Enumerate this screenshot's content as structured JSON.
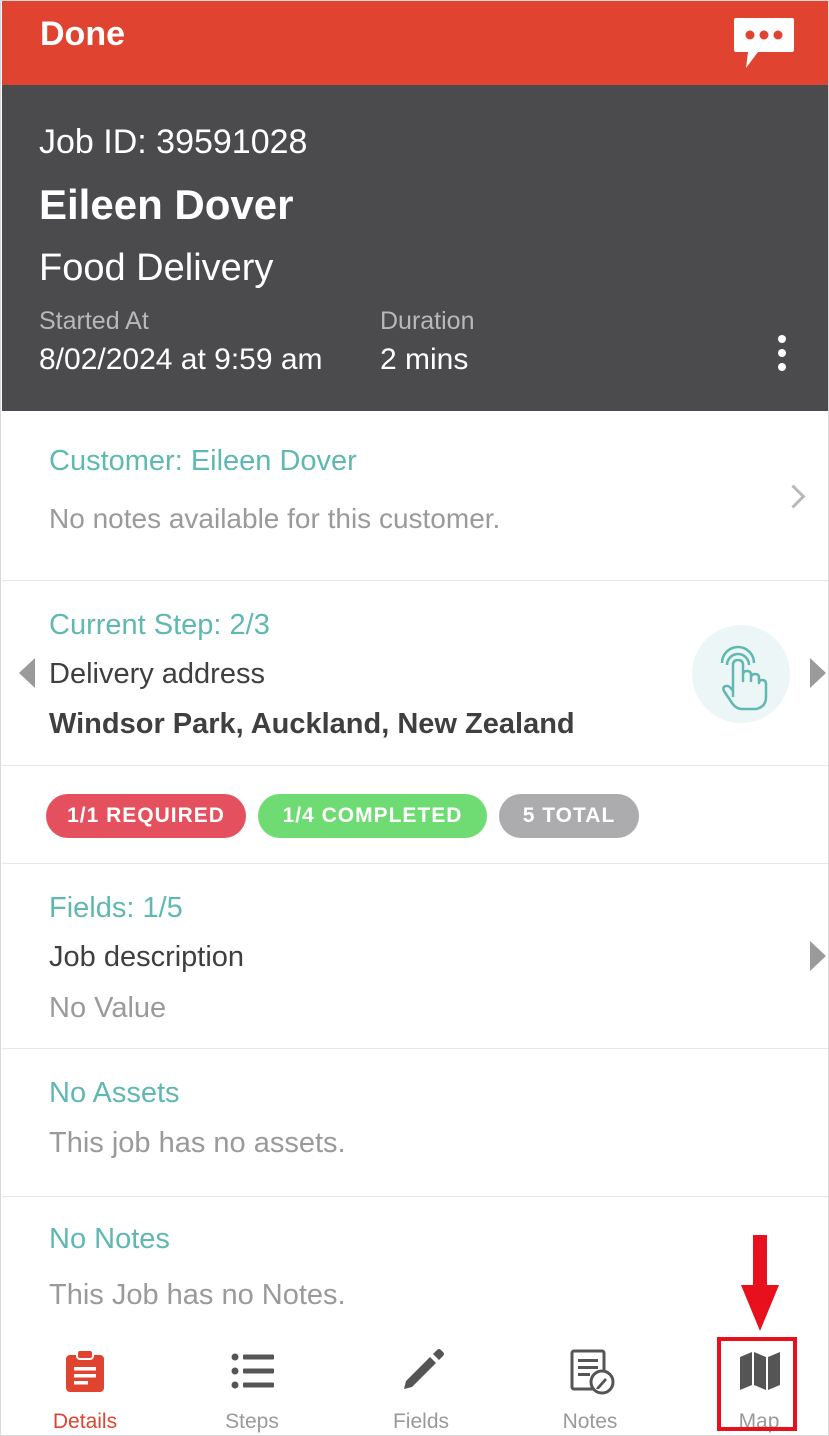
{
  "topbar": {
    "done_label": "Done",
    "chat_icon": "chat-bubble-icon",
    "color": "#e0432f"
  },
  "header": {
    "job_id": "Job ID: 39591028",
    "customer_name": "Eileen Dover",
    "job_type": "Food Delivery",
    "started_label": "Started At",
    "started_value": "8/02/2024 at 9:59 am",
    "duration_label": "Duration",
    "duration_value": "2 mins",
    "bg_color": "#4b4a4d"
  },
  "customer": {
    "title": "Customer: Eileen Dover",
    "notes": "No notes available for this customer."
  },
  "step": {
    "title": "Current Step: 2/3",
    "name": "Delivery address",
    "value": "Windsor Park, Auckland, New Zealand"
  },
  "badges": [
    {
      "label": "1/1 REQUIRED",
      "color": "#e5505e"
    },
    {
      "label": "1/4 COMPLETED",
      "color": "#6edc73"
    },
    {
      "label": "5 TOTAL",
      "color": "#acabad"
    }
  ],
  "fields": {
    "title": "Fields: 1/5",
    "name": "Job description",
    "value": "No Value"
  },
  "assets": {
    "title": "No Assets",
    "text": "This job has no assets."
  },
  "notes": {
    "title": "No Notes",
    "text": "This Job has no Notes."
  },
  "tabs": [
    {
      "label": "Details",
      "icon": "clipboard-icon",
      "active": true
    },
    {
      "label": "Steps",
      "icon": "list-icon",
      "active": false
    },
    {
      "label": "Fields",
      "icon": "pencil-icon",
      "active": false
    },
    {
      "label": "Notes",
      "icon": "notes-icon",
      "active": false
    },
    {
      "label": "Map",
      "icon": "map-icon",
      "active": false
    }
  ],
  "annotation_color": "#e8101c",
  "accent_teal": "#5fb8b1"
}
